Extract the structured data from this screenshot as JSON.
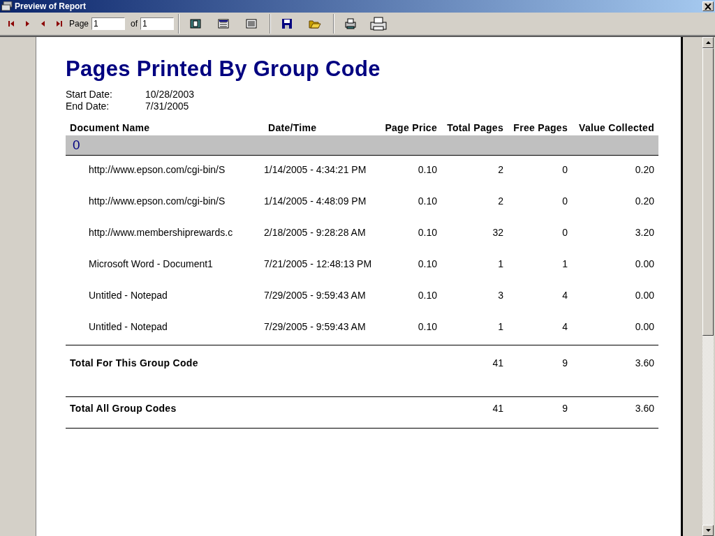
{
  "window": {
    "title": "Preview of Report"
  },
  "toolbar": {
    "page_label": "Page",
    "page_value": "1",
    "of_label": "of",
    "of_value": "1"
  },
  "report": {
    "title": "Pages Printed By Group Code",
    "dates": [
      {
        "label": "Start Date:",
        "value": "10/28/2003"
      },
      {
        "label": "End Date:",
        "value": "7/31/2005"
      }
    ],
    "columns": [
      "Document Name",
      "Date/Time",
      "Page Price",
      "Total Pages",
      "Free Pages",
      "Value Collected"
    ],
    "group": "0",
    "rows": [
      [
        "http://www.epson.com/cgi-bin/S",
        "1/14/2005 - 4:34:21 PM",
        "0.10",
        "2",
        "0",
        "0.20"
      ],
      [
        "http://www.epson.com/cgi-bin/S",
        "1/14/2005 - 4:48:09 PM",
        "0.10",
        "2",
        "0",
        "0.20"
      ],
      [
        "http://www.membershiprewards.c",
        "2/18/2005 - 9:28:28 AM",
        "0.10",
        "32",
        "0",
        "3.20"
      ],
      [
        "Microsoft Word - Document1",
        "7/21/2005 - 12:48:13 PM",
        "0.10",
        "1",
        "1",
        "0.00"
      ],
      [
        "Untitled - Notepad",
        "7/29/2005 - 9:59:43 AM",
        "0.10",
        "3",
        "4",
        "0.00"
      ],
      [
        "Untitled - Notepad",
        "7/29/2005 - 9:59:43 AM",
        "0.10",
        "1",
        "4",
        "0.00"
      ]
    ],
    "totals": [
      {
        "label": "Total For This Group Code",
        "total_pages": "41",
        "free_pages": "9",
        "value": "3.60"
      },
      {
        "label": "Total All Group Codes",
        "total_pages": "41",
        "free_pages": "9",
        "value": "3.60"
      }
    ]
  }
}
